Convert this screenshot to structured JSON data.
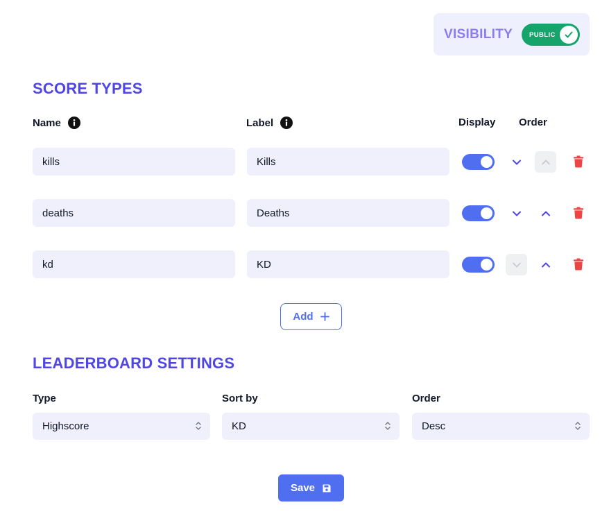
{
  "visibility": {
    "label": "VISIBILITY",
    "state": "PUBLIC",
    "enabled": true,
    "color": "#16a46a"
  },
  "score_types": {
    "title": "SCORE TYPES",
    "headers": {
      "name": "Name",
      "label": "Label",
      "display": "Display",
      "order": "Order"
    },
    "rows": [
      {
        "name": "kills",
        "label": "Kills",
        "display": true,
        "down_enabled": true,
        "up_enabled": false
      },
      {
        "name": "deaths",
        "label": "Deaths",
        "display": true,
        "down_enabled": true,
        "up_enabled": true
      },
      {
        "name": "kd",
        "label": "KD",
        "display": true,
        "down_enabled": false,
        "up_enabled": true
      }
    ],
    "add_label": "Add"
  },
  "leaderboard": {
    "title": "LEADERBOARD SETTINGS",
    "type": {
      "label": "Type",
      "value": "Highscore"
    },
    "sort_by": {
      "label": "Sort by",
      "value": "KD"
    },
    "order": {
      "label": "Order",
      "value": "Desc"
    }
  },
  "save_label": "Save",
  "colors": {
    "accent": "#4f46e5",
    "primary": "#4f6ef0",
    "danger": "#ef4444",
    "field_bg": "#f0f0fd"
  },
  "icons": {
    "info": "info-icon",
    "down": "chevron-down-icon",
    "up": "chevron-up-icon",
    "trash": "trash-icon",
    "plus": "plus-icon",
    "save": "save-icon",
    "check": "check-icon",
    "select": "chevron-up-down-icon"
  }
}
